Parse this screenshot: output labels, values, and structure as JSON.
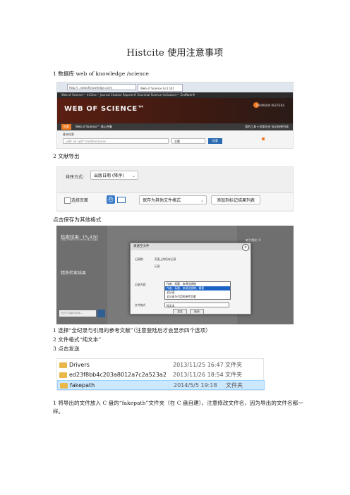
{
  "doc": {
    "title": "Histcite 使用注意事项",
    "step1": "1 数据库 web of knowledge /science",
    "step2": "2 文献导出",
    "click_save": "点击保存为其他格式",
    "note1": "1 选择“全纪录与引用的参考文献”（注意登陆后才会显示四个选项）",
    "note2": "2 文件格式“纯文本”",
    "note3": "3 点击发送",
    "final": "1 将导出的文件放入 C 盘的“fakepath”文件夹（在 C 盘自建），注意修改文件名，因为导出的文件名都一样。"
  },
  "wos": {
    "address": "http://...webofknowledge.com/",
    "tab": "Web of Science [v.5.14]",
    "nav": "Web of Science™   InCites™   Journal Citation Reports®   Essential Science Indicators℠   EndNote®",
    "logo": "WEB OF SCIENCE™",
    "publisher": "THOMSON REUTERS",
    "search_btn": "检索",
    "database": "Web of Science™ 核心合集",
    "links": "我的工具 ▾   检索历史   标记结果列表",
    "basic": "基本检索",
    "search_placeholder": "示例: oil spill* mediterranean",
    "field": "主题",
    "go": "检索"
  },
  "export": {
    "sort_label": "排序方式:",
    "sort_value": "出版日期 (降序)",
    "select_page": "选择页面",
    "save_format": "保存为其他文件格式",
    "add_marked": "添加到标记结果列表"
  },
  "dialog": {
    "results_label": "检索结果: 15,430",
    "results_sub": "(来自 Web of Science 核心合集)",
    "refine": "精炼检索结果",
    "search_in": "在如下结果中检索...",
    "right_info": "被引频次: 0",
    "title": "发送至文件",
    "record_label": "记录数:",
    "opt_page": "页面上的所有记录",
    "opt_range": "记录",
    "content_label": "记录内容:",
    "options": [
      "作者、标题、来源出版物",
      "作者、标题、来源出版物、摘要",
      "全记录",
      "全记录与引用的参考文献"
    ],
    "highlight": 1,
    "format_label": "文件格式",
    "format_value": "纯文本",
    "send": "发送",
    "cancel": "取消"
  },
  "files": [
    {
      "name": "Drivers",
      "date": "2013/11/25 16:47",
      "type": "文件夹"
    },
    {
      "name": "ed23f8bb4c203a8012a7c2a523a2",
      "date": "2013/11/26 18:54",
      "type": "文件夹"
    },
    {
      "name": "fakepath",
      "date": "2014/5/5 19:18",
      "type": "文件夹"
    }
  ]
}
